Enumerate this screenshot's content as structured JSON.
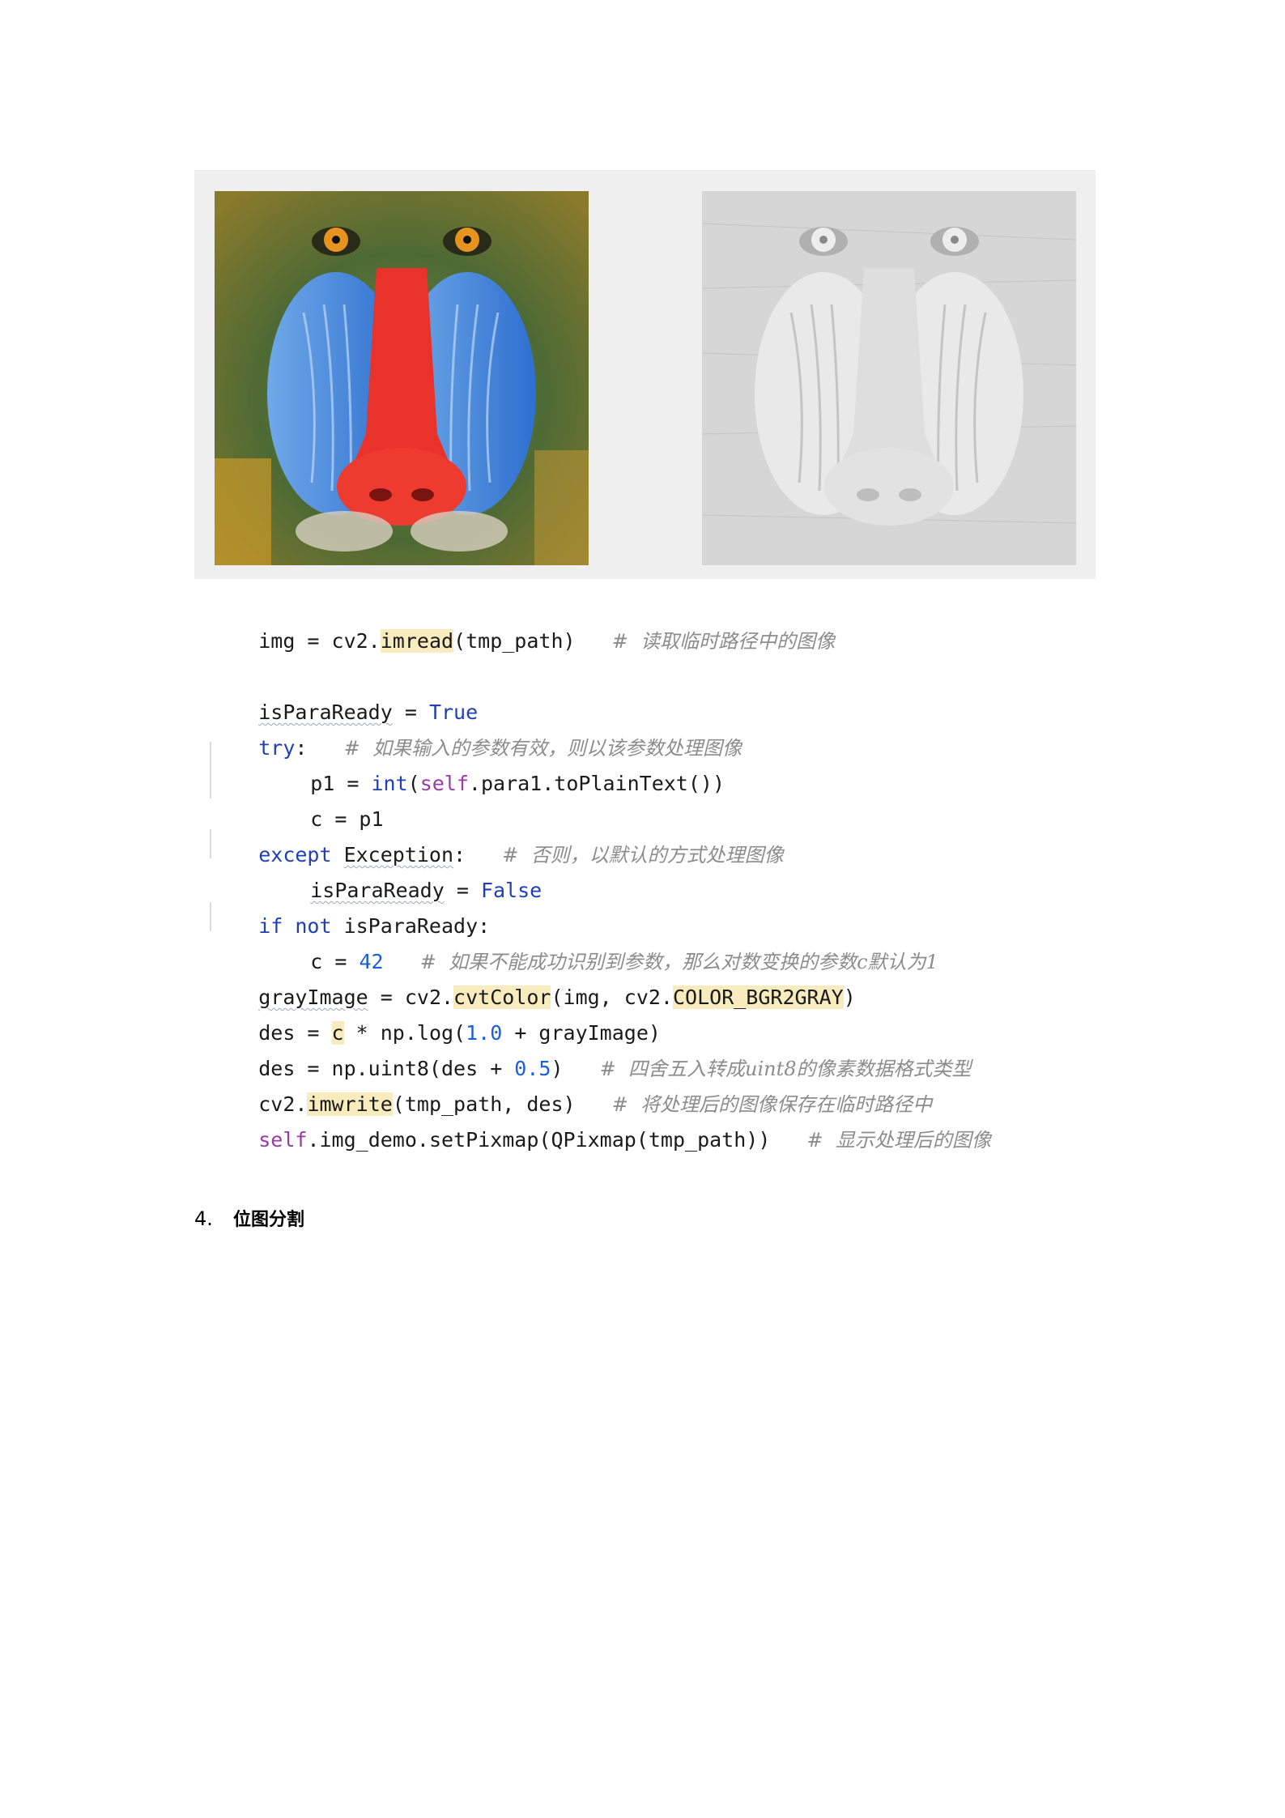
{
  "figure": {
    "left_image": {
      "description_icon": "mandrill-color-image"
    },
    "right_image": {
      "description_icon": "mandrill-log-transform-image"
    }
  },
  "code": {
    "line1": {
      "a": "img = cv2.",
      "b": "imread",
      "c": "(tmp_path)",
      "cmt": "#  读取临时路径中的图像"
    },
    "line2": {
      "a": "isParaReady",
      "b": " = ",
      "c": "True"
    },
    "line3": {
      "a": "try",
      "b": ":",
      "cmt": "#  如果输入的参数有效，则以该参数处理图像"
    },
    "line4": {
      "a": "p1 = ",
      "b": "int",
      "c": "(",
      "d": "self",
      "e": ".para1.toPlainText())"
    },
    "line5": {
      "a": "c = p1"
    },
    "line6": {
      "a": "except ",
      "b": "Exception",
      "c": ":",
      "cmt": "#  否则，以默认的方式处理图像"
    },
    "line7": {
      "a": "isParaReady",
      "b": " = ",
      "c": "False"
    },
    "line8": {
      "a": "if not ",
      "b": "isParaReady:"
    },
    "line9": {
      "a": "c = ",
      "b": "42",
      "cmt": "#  如果不能成功识别到参数，那么对数变换的参数c默认为1"
    },
    "line10": {
      "a": "grayImage",
      "b": " = cv2.",
      "c": "cvtColor",
      "d": "(img, cv2.",
      "e": "COLOR_BGR2GRAY",
      "f": ")"
    },
    "line11": {
      "a": "des = ",
      "b": "c",
      "c": " * np.log(",
      "d": "1.0",
      "e": " + grayImage)"
    },
    "line12": {
      "a": "des = np.uint8(des + ",
      "b": "0.5",
      "c": ")",
      "cmt": "#  四舍五入转成uint8的像素数据格式类型"
    },
    "line13": {
      "a": "cv2.",
      "b": "imwrite",
      "c": "(tmp_path, des)",
      "cmt": "#  将处理后的图像保存在临时路径中"
    },
    "line14": {
      "a": "self",
      "b": ".img_demo.setPixmap(QPixmap(tmp_path))",
      "cmt": "#  显示处理后的图像"
    }
  },
  "section": {
    "number": "4.",
    "title": "位图分割"
  }
}
